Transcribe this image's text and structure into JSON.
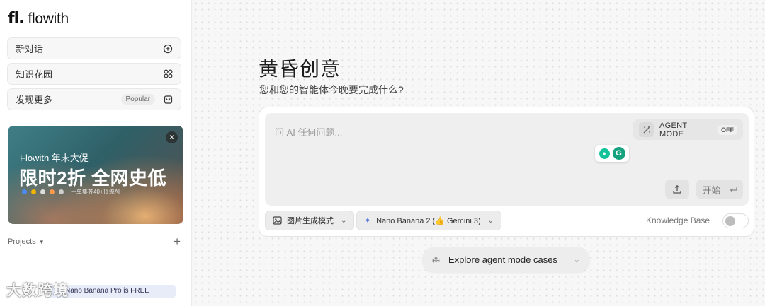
{
  "sidebar": {
    "logo_mark": "fl.",
    "logo_text": "flowith",
    "nav": [
      {
        "label": "新对话",
        "icon": "new-chat-icon"
      },
      {
        "label": "知识花园",
        "icon": "grid-icon"
      },
      {
        "label": "发现更多",
        "badge": "Popular",
        "icon": "bag-icon"
      }
    ],
    "promo": {
      "close": "×",
      "small_title": "Flowith 年末大促",
      "big_title": "限时2折 全网史低",
      "caption": "一单集齐40+顶流AI"
    },
    "projects_label": "Projects",
    "projects_add": "+",
    "free_banner": "Nano Banana Pro is FREE",
    "watermark": "大数跨境"
  },
  "main": {
    "title": "黄昏创意",
    "subtitle": "您和您的智能体今晚要完成什么?",
    "input": {
      "placeholder": "问 AI 任何问题..."
    },
    "agent_mode": {
      "label": "AGENT MODE",
      "state": "OFF"
    },
    "start_label": "开始",
    "mode_pill": "图片生成模式",
    "model_pill": "Nano Banana 2 (👍 Gemini 3)",
    "knowledge_base": "Knowledge Base",
    "explore": "Explore agent mode cases"
  },
  "colors": {
    "sidebar_bg": "#ffffff",
    "main_bg": "#f7f7f7",
    "accent_green": "#15a37f"
  }
}
